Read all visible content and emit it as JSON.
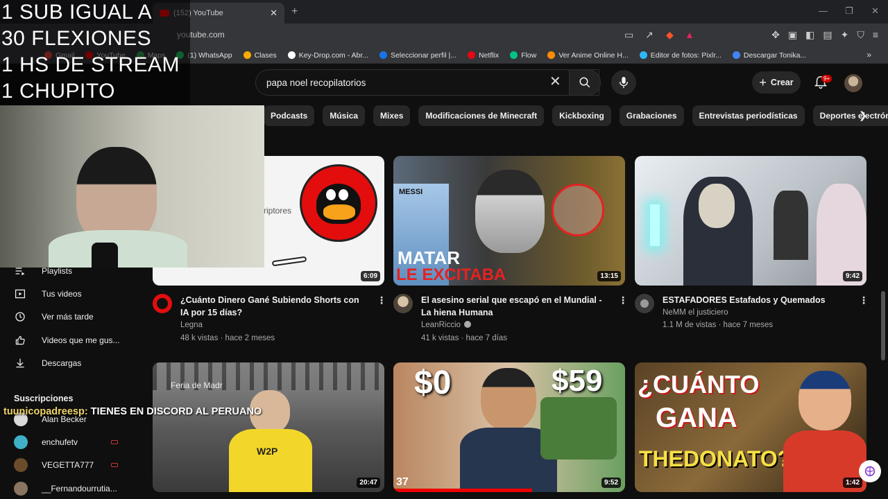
{
  "browser": {
    "tab_title": "(152) YouTube",
    "tab_close": "✕",
    "new_tab": "+",
    "url": "youtube.com",
    "bookmarks": [
      {
        "label": "Gmail",
        "color": "#ea4335"
      },
      {
        "label": "YouTube",
        "color": "#ff0000"
      },
      {
        "label": "Maps",
        "color": "#34a853"
      },
      {
        "label": "(1) WhatsApp",
        "color": "#25d366"
      },
      {
        "label": "Clases",
        "color": "#f9ab00"
      },
      {
        "label": "Key-Drop.com - Abr...",
        "color": "#ffffff"
      },
      {
        "label": "Seleccionar perfil |...",
        "color": "#1a73e8"
      },
      {
        "label": "Netflix",
        "color": "#e50914"
      },
      {
        "label": "Flow",
        "color": "#00c389"
      },
      {
        "label": "Ver Anime Online H...",
        "color": "#ff8c00"
      },
      {
        "label": "Editor de fotos: Pixlr...",
        "color": "#2fb7f5"
      },
      {
        "label": "Descargar Tonika...",
        "color": "#4285f4"
      }
    ],
    "bookmarks_more": "»"
  },
  "youtube": {
    "search_query": "papa noel recopilatorios",
    "create_label": "Crear",
    "notifications_badge": "9+",
    "chips": [
      "Podcasts",
      "Música",
      "Mixes",
      "Modificaciones de Minecraft",
      "Kickboxing",
      "Grabaciones",
      "Entrevistas periodísticas",
      "Deportes electrónicos"
    ],
    "sidebar": [
      {
        "label": "Playlists",
        "icon": "playlist-icon"
      },
      {
        "label": "Tus videos",
        "icon": "your-videos-icon"
      },
      {
        "label": "Ver más tarde",
        "icon": "clock-icon"
      },
      {
        "label": "Videos que me gus...",
        "icon": "thumbs-up-icon"
      },
      {
        "label": "Descargas",
        "icon": "download-icon"
      }
    ],
    "subscriptions_header": "Suscripciones",
    "subscriptions": [
      {
        "label": "Alan Becker",
        "color": "#d9d9d9"
      },
      {
        "label": "enchufetv",
        "color": "#3fb0c8"
      },
      {
        "label": "VEGETTA777",
        "color": "#6a4c2a"
      },
      {
        "label": "__Fernandourrutia...",
        "color": "#8a7560"
      }
    ],
    "videos": [
      {
        "title": "¿Cuánto Dinero Gané Subiendo Shorts con IA por 15 días?",
        "channel": "Legna",
        "verified": false,
        "meta": "48 k vistas · hace 2 meses",
        "duration": "6:09"
      },
      {
        "title": "El asesino serial que escapó en el Mundial - La hiena Humana",
        "channel": "LeanRiccio",
        "verified": true,
        "meta": "41 k vistas · hace 7 días",
        "duration": "13:15"
      },
      {
        "title": "ESTAFADORES Estafados y Quemados",
        "channel": "NeMM el justiciero",
        "verified": false,
        "meta": "1.1 M de vistas · hace 7 meses",
        "duration": "9:42"
      },
      {
        "duration": "20:47"
      },
      {
        "duration": "9:52"
      },
      {
        "duration": "1:42"
      }
    ],
    "thumb_text": {
      "t1_text": "riptores",
      "t2_line1": "MATAR",
      "t2_line2": "LE EXCITABA",
      "t2_jersey": "MESSI",
      "t4_sign": "Feria de Madr",
      "t4_shirt": "W2P",
      "t5_left": "$0",
      "t5_right": "$59",
      "t5_counter": "37",
      "t6_line1": "¿CUÁNTO",
      "t6_line2": "GANA",
      "t6_line3": "THEDONATO?"
    }
  },
  "stream": {
    "overlay_lines": [
      "1 SUB IGUAL A",
      "30 FLEXIONES",
      "1 HS DE STREAM",
      "1 CHUPITO"
    ],
    "chat_user": "tuunicopadreesp:",
    "chat_text": " TIENES EN DISCORD AL PERUANO"
  },
  "colors": {
    "background": "#0f0f0f",
    "chip": "#272727",
    "accent_red": "#ff0000",
    "meta_gray": "#aaaaaa"
  }
}
